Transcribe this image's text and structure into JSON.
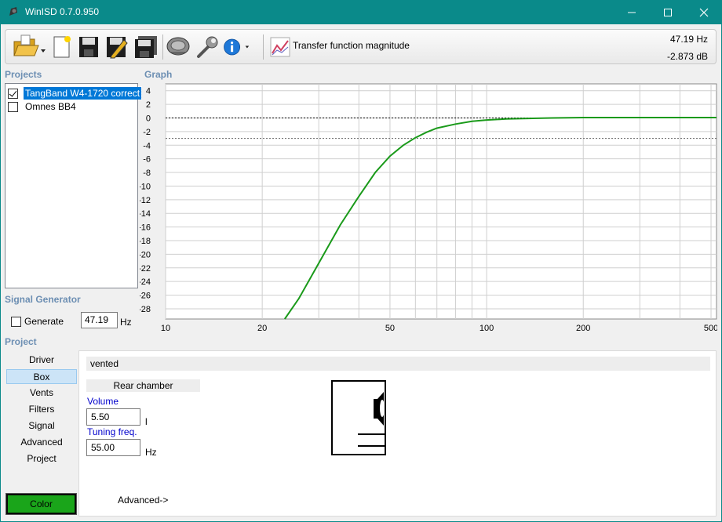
{
  "window": {
    "title": "WinISD 0.7.0.950"
  },
  "toolbar": {
    "graph_selector_label": "Transfer function magnitude"
  },
  "readout": {
    "frequency": "47.19 Hz",
    "level": "-2.873 dB"
  },
  "sections": {
    "projects": "Projects",
    "graph": "Graph",
    "signal_generator": "Signal Generator",
    "project": "Project"
  },
  "projects": [
    {
      "name": "TangBand W4-1720 correct",
      "checked": true,
      "selected": true
    },
    {
      "name": "Omnes BB4",
      "checked": false,
      "selected": false
    }
  ],
  "signal_generator": {
    "generate_label": "Generate",
    "frequency_value": "47.19",
    "unit": "Hz"
  },
  "nav": [
    "Driver",
    "Box",
    "Vents",
    "Filters",
    "Signal",
    "Advanced",
    "Project"
  ],
  "nav_selected": "Box",
  "color_button_label": "Color",
  "colors": {
    "curve": "#1a9a1a",
    "color_button": "#1aa51a",
    "titlebar": "#0a8a8a",
    "selection": "#0078d7"
  },
  "box_panel": {
    "type": "vented",
    "subheading": "Rear chamber",
    "volume_label": "Volume",
    "volume_value": "5.50",
    "volume_unit": "l",
    "tuning_label": "Tuning freq.",
    "tuning_value": "55.00",
    "tuning_unit": "Hz",
    "advanced_link": "Advanced->"
  },
  "chart_data": {
    "type": "line",
    "title": "",
    "xlabel": "",
    "ylabel": "",
    "x_scale": "log",
    "xlim": [
      10,
      520
    ],
    "ylim": [
      -29.5,
      5
    ],
    "x_ticks": [
      10,
      20,
      50,
      100,
      200,
      500
    ],
    "y_ticks": [
      4,
      2,
      0,
      -2,
      -4,
      -6,
      -8,
      -10,
      -12,
      -14,
      -16,
      -18,
      -20,
      -22,
      -24,
      -26,
      -28
    ],
    "reference_lines": [
      0,
      -3
    ],
    "grid": true,
    "series": [
      {
        "color": "#1a9a1a",
        "x": [
          23.5,
          26,
          30,
          35,
          40,
          45,
          50,
          55,
          60,
          65,
          70,
          80,
          90,
          100,
          115,
          130,
          160,
          200,
          300,
          400,
          520
        ],
        "y": [
          -30,
          -26.5,
          -21.3,
          -15.7,
          -11.5,
          -8,
          -5.6,
          -4.0,
          -2.9,
          -2.1,
          -1.5,
          -0.9,
          -0.5,
          -0.3,
          -0.15,
          -0.08,
          0.0,
          0.05,
          0.05,
          0.05,
          0.05
        ]
      }
    ]
  }
}
